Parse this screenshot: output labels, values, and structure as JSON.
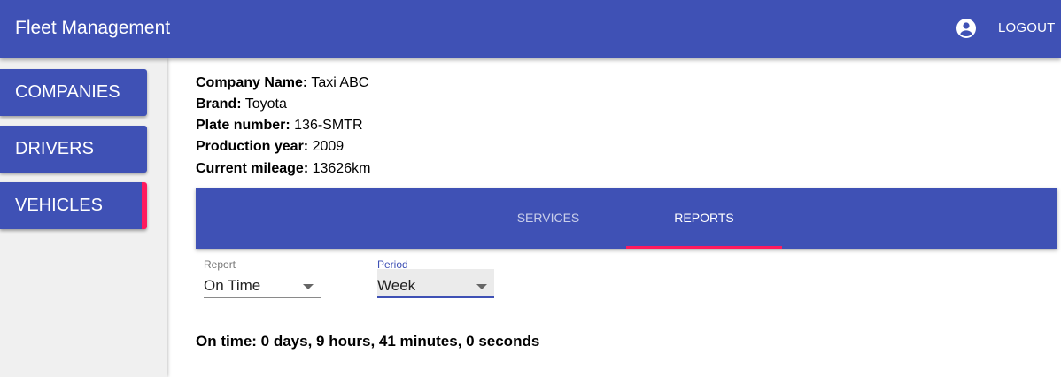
{
  "appbar": {
    "title": "Fleet Management",
    "account_icon": "account-circle-icon",
    "logout_label": "LOGOUT"
  },
  "sidebar": {
    "items": [
      {
        "label": "COMPANIES",
        "active": false
      },
      {
        "label": "DRIVERS",
        "active": false
      },
      {
        "label": "VEHICLES",
        "active": true
      }
    ]
  },
  "vehicle": {
    "company_label": "Company Name:",
    "company_value": "Taxi ABC",
    "brand_label": "Brand:",
    "brand_value": "Toyota",
    "plate_label": "Plate number:",
    "plate_value": "136-SMTR",
    "year_label": "Production year:",
    "year_value": "2009",
    "mileage_label": "Current mileage:",
    "mileage_value": "13626km"
  },
  "tabs": [
    {
      "label": "SERVICES",
      "selected": false
    },
    {
      "label": "REPORTS",
      "selected": true
    }
  ],
  "filters": {
    "report_label": "Report",
    "report_value": "On Time",
    "period_label": "Period",
    "period_value": "Week"
  },
  "result": {
    "text": "On time: 0 days, 9 hours, 41 minutes, 0 seconds"
  },
  "colors": {
    "primary": "#3f51b5",
    "accent": "#ff1a5e"
  }
}
